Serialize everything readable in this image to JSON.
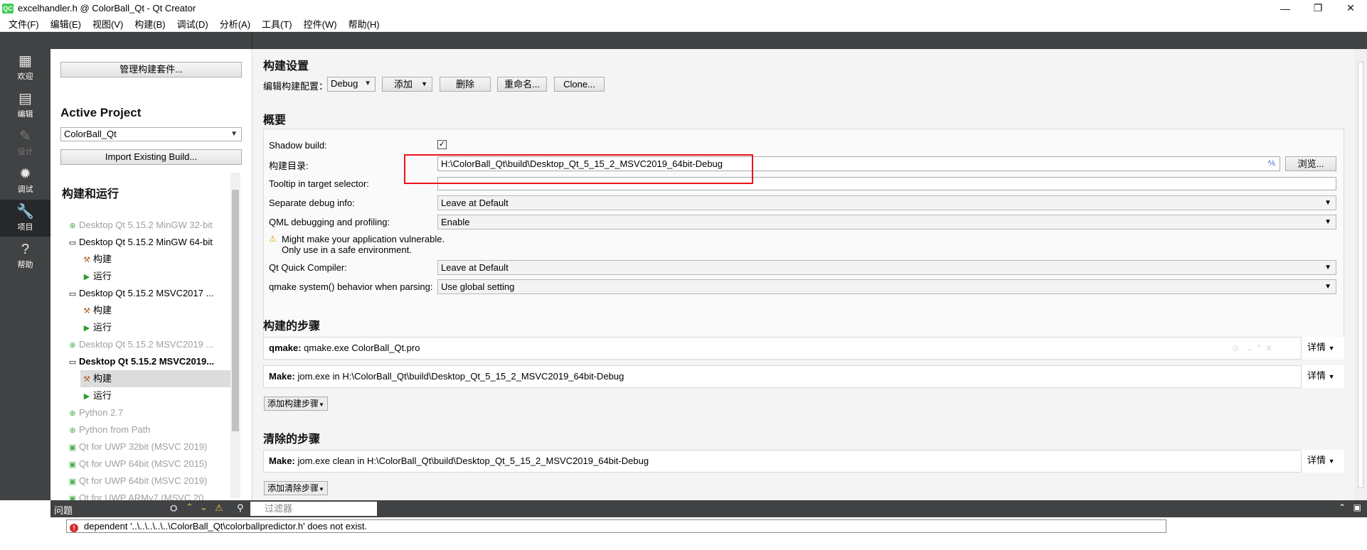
{
  "window": {
    "icon_text": "QC",
    "title": "excelhandler.h @ ColorBall_Qt - Qt Creator",
    "minimize": "—",
    "restore": "❐",
    "close": "✕"
  },
  "menubar": [
    "文件(F)",
    "编辑(E)",
    "视图(V)",
    "构建(B)",
    "调试(D)",
    "分析(A)",
    "工具(T)",
    "控件(W)",
    "帮助(H)"
  ],
  "modes": [
    {
      "icon": "grid-icon",
      "glyph": "▦",
      "label": "欢迎"
    },
    {
      "icon": "edit-icon",
      "glyph": "▤",
      "label": "编辑"
    },
    {
      "icon": "design-icon",
      "glyph": "✎",
      "label": "设计"
    },
    {
      "icon": "debug-icon",
      "glyph": "✹",
      "label": "调试"
    },
    {
      "icon": "wrench-icon",
      "glyph": "🔧",
      "label": "项目"
    },
    {
      "icon": "help-icon",
      "glyph": "?",
      "label": "帮助"
    }
  ],
  "nav": {
    "manage_kits": "管理构建套件...",
    "active_project_label": "Active Project",
    "active_project": "ColorBall_Qt",
    "import_build": "Import Existing Build...",
    "build_run_label": "构建和运行",
    "tree": [
      {
        "text": "Desktop Qt 5.15.2 MinGW 32-bit",
        "icon": "plus-icon",
        "glyph": "⊕"
      },
      {
        "text": "Desktop Qt 5.15.2 MinGW 64-bit",
        "icon": "monitor-icon",
        "glyph": "▭"
      },
      {
        "text": "构建",
        "icon": "hammer-icon",
        "glyph": "⚒"
      },
      {
        "text": "运行",
        "icon": "run-icon",
        "glyph": "▶"
      },
      {
        "text": "Desktop Qt 5.15.2 MSVC2017 ...",
        "icon": "monitor-icon",
        "glyph": "▭"
      },
      {
        "text": "构建",
        "icon": "hammer-icon",
        "glyph": "⚒"
      },
      {
        "text": "运行",
        "icon": "run-icon",
        "glyph": "▶"
      },
      {
        "text": "Desktop Qt 5.15.2 MSVC2019 ...",
        "icon": "plus-icon",
        "glyph": "⊕"
      },
      {
        "text": "Desktop Qt 5.15.2 MSVC2019...",
        "icon": "monitor-icon",
        "glyph": "▭"
      },
      {
        "text": "构建",
        "icon": "hammer-icon",
        "glyph": "⚒"
      },
      {
        "text": "运行",
        "icon": "run-icon",
        "glyph": "▶"
      },
      {
        "text": "Python 2.7",
        "icon": "plus-icon",
        "glyph": "⊕"
      },
      {
        "text": "Python from Path",
        "icon": "plus-icon",
        "glyph": "⊕"
      },
      {
        "text": "Qt  for UWP 32bit (MSVC 2019)",
        "icon": "kit-icon",
        "glyph": "▣"
      },
      {
        "text": "Qt  for UWP 64bit (MSVC 2015)",
        "icon": "kit-icon",
        "glyph": "▣"
      },
      {
        "text": "Qt  for UWP 64bit (MSVC 2019)",
        "icon": "kit-icon",
        "glyph": "▣"
      },
      {
        "text": "Qt  for UWP ARMv7 (MSVC 20...",
        "icon": "kit-icon",
        "glyph": "▣"
      }
    ]
  },
  "build_settings": {
    "title": "构建设置",
    "edit_config_label": "编辑构建配置：",
    "config_value": "Debug",
    "add": "添加",
    "delete": "删除",
    "rename": "重命名...",
    "clone": "Clone..."
  },
  "overview": {
    "title": "概要",
    "shadow_build_label": "Shadow build:",
    "shadow_build_checked": "✓",
    "build_dir_label": "构建目录:",
    "build_dir_value": "H:\\ColorBall_Qt\\build\\Desktop_Qt_5_15_2_MSVC2019_64bit-Debug",
    "browse": "浏览...",
    "tooltip_label": "Tooltip in target selector:",
    "tooltip_value": "",
    "sep_debug_label": "Separate debug info:",
    "sep_debug_value": "Leave at Default",
    "qml_label": "QML debugging and profiling:",
    "qml_value": "Enable",
    "warning_line1": "Might make your application vulnerable.",
    "warning_line2": "Only use in a safe environment.",
    "qtquick_label": "Qt Quick Compiler:",
    "qtquick_value": "Leave at Default",
    "qmake_sys_label": "qmake system() behavior when parsing:",
    "qmake_sys_value": "Use global setting"
  },
  "build_steps": {
    "title": "构建的步骤",
    "steps": [
      {
        "name": "qmake:",
        "detail": "qmake.exe ColorBall_Qt.pro",
        "details_btn": "详情"
      },
      {
        "name": "Make:",
        "detail": "jom.exe in H:\\ColorBall_Qt\\build\\Desktop_Qt_5_15_2_MSVC2019_64bit-Debug",
        "details_btn": "详情"
      }
    ],
    "add_step": "添加构建步骤"
  },
  "clean_steps": {
    "title": "清除的步骤",
    "steps": [
      {
        "name": "Make:",
        "detail": "jom.exe clean in H:\\ColorBall_Qt\\build\\Desktop_Qt_5_15_2_MSVC2019_64bit-Debug",
        "details_btn": "详情"
      }
    ],
    "add_step": "添加清除步骤"
  },
  "issues": {
    "title": "问题",
    "filter_placeholder": "过滤器",
    "message": "dependent '..\\..\\..\\..\\..\\ColorBall_Qt\\colorballpredictor.h' does not exist."
  }
}
